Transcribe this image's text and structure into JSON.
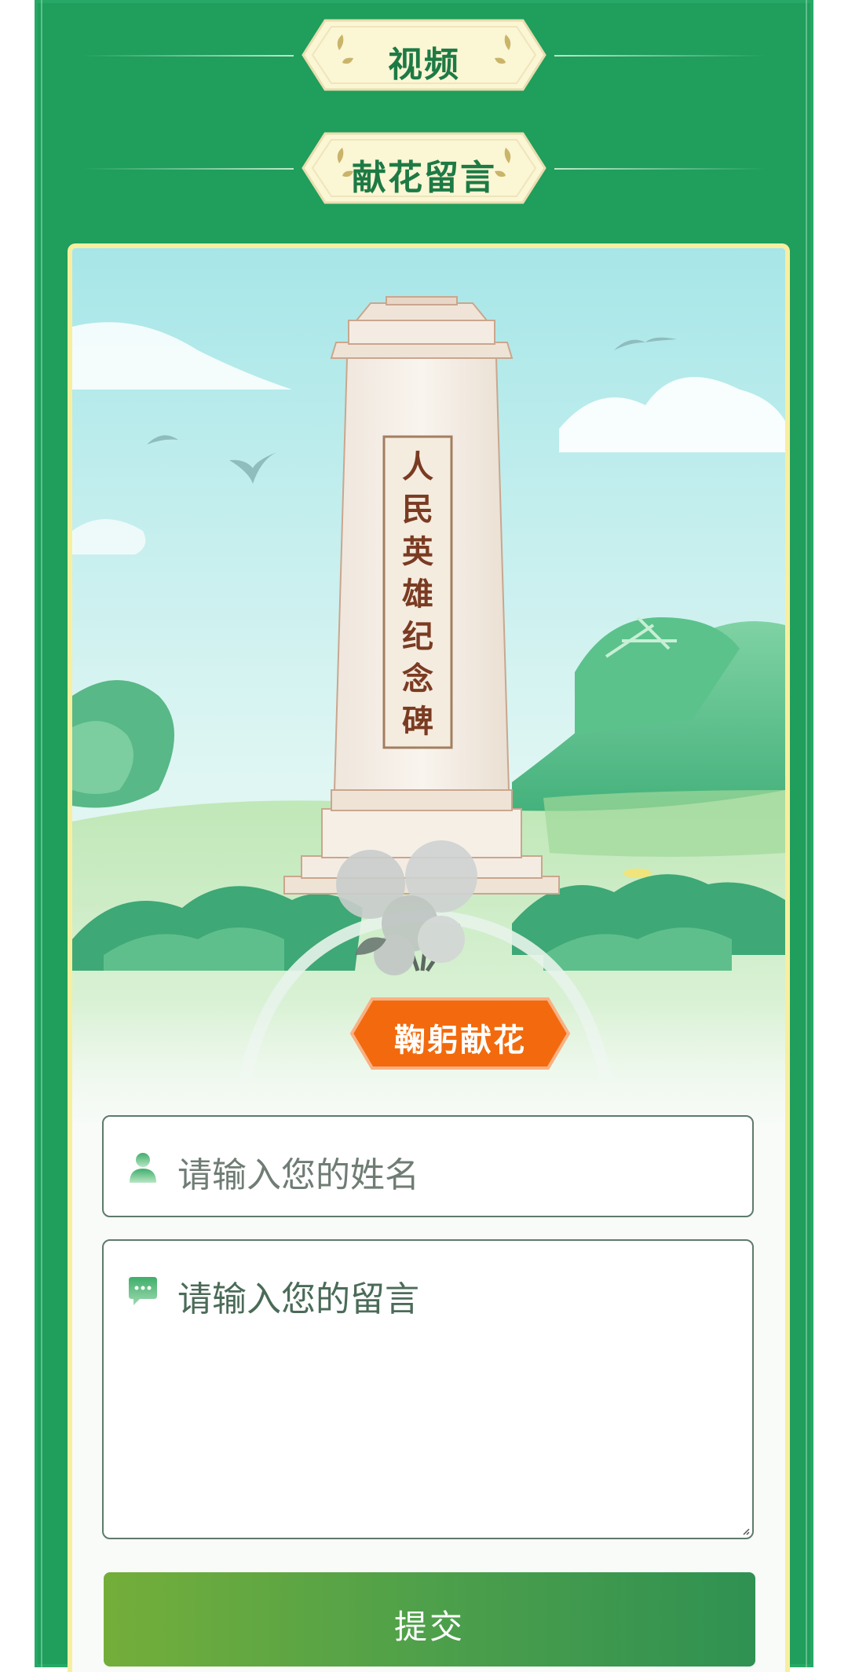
{
  "sections": {
    "video_title": "视频",
    "tribute_title": "献花留言"
  },
  "monument": {
    "inscription": [
      "人",
      "民",
      "英",
      "雄",
      "纪",
      "念",
      "碑"
    ]
  },
  "tribute": {
    "bow_button_label": "鞠躬献花"
  },
  "form": {
    "name_placeholder": "请输入您的姓名",
    "message_placeholder": "请输入您的留言",
    "submit_label": "提交"
  },
  "icons": {
    "name": "user-icon",
    "message": "chat-icon"
  },
  "colors": {
    "page_green": "#1f9e5c",
    "badge_cream": "#fbf6d4",
    "title_green": "#1d7a45",
    "button_orange": "#f26a0d",
    "card_border": "#f7ef9f"
  }
}
